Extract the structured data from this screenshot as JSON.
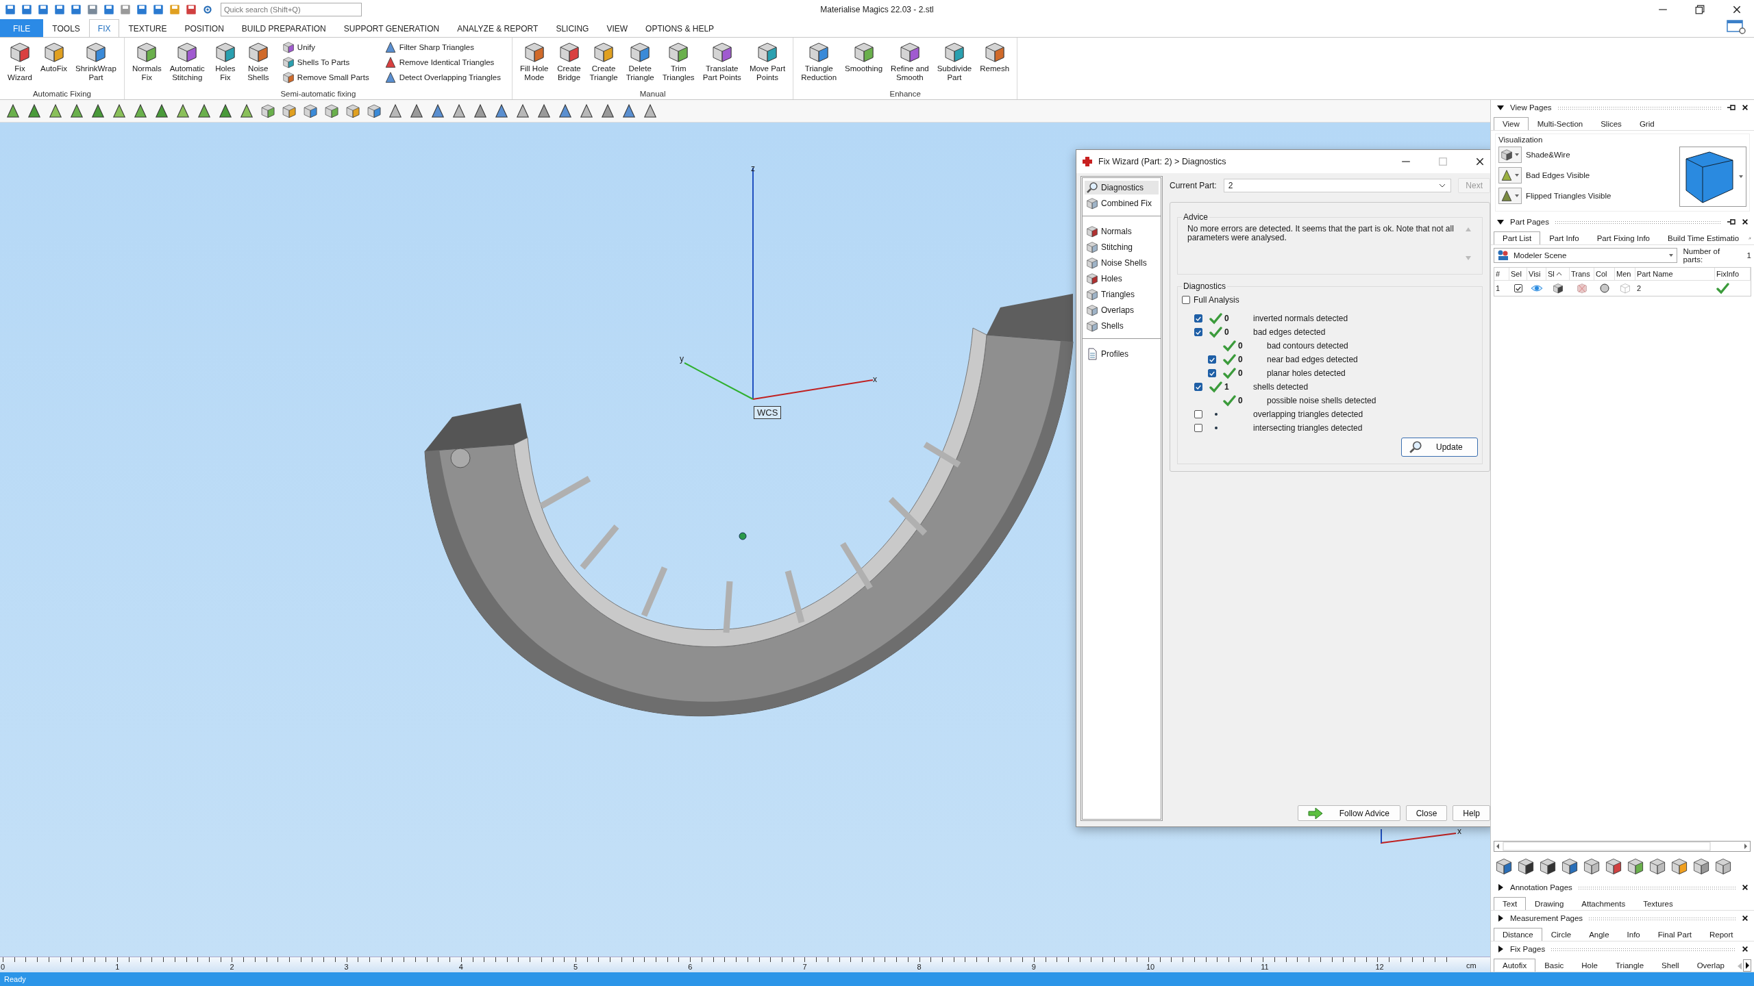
{
  "window": {
    "title": "Materialise Magics 22.03 - 2.stl"
  },
  "quick_search": {
    "placeholder": "Quick search (Shift+Q)"
  },
  "ribbon": {
    "tabs": [
      {
        "label": "FILE",
        "kind": "file",
        "selected": false
      },
      {
        "label": "TOOLS",
        "kind": "tab",
        "selected": false
      },
      {
        "label": "FIX",
        "kind": "tab",
        "selected": true
      },
      {
        "label": "TEXTURE",
        "kind": "tab",
        "selected": false
      },
      {
        "label": "POSITION",
        "kind": "tab",
        "selected": false
      },
      {
        "label": "BUILD PREPARATION",
        "kind": "tab",
        "selected": false
      },
      {
        "label": "SUPPORT GENERATION",
        "kind": "tab",
        "selected": false
      },
      {
        "label": "ANALYZE & REPORT",
        "kind": "tab",
        "selected": false
      },
      {
        "label": "SLICING",
        "kind": "tab",
        "selected": false
      },
      {
        "label": "VIEW",
        "kind": "tab",
        "selected": false
      },
      {
        "label": "OPTIONS & HELP",
        "kind": "tab",
        "selected": false
      }
    ],
    "groups": [
      {
        "label": "Automatic Fixing",
        "items": [
          {
            "kind": "large",
            "label": "Fix\nWizard"
          },
          {
            "kind": "large",
            "label": "AutoFix"
          },
          {
            "kind": "large",
            "label": "ShrinkWrap\nPart"
          }
        ]
      },
      {
        "label": "Semi-automatic fixing",
        "items": [
          {
            "kind": "large",
            "label": "Normals\nFix"
          },
          {
            "kind": "large",
            "label": "Automatic\nStitching"
          },
          {
            "kind": "large",
            "label": "Holes\nFix"
          },
          {
            "kind": "large",
            "label": "Noise\nShells"
          },
          {
            "kind": "small",
            "label": "Unify"
          },
          {
            "kind": "small",
            "label": "Shells To Parts"
          },
          {
            "kind": "small",
            "label": "Remove Small Parts"
          },
          {
            "kind": "small",
            "label": "Filter Sharp Triangles"
          },
          {
            "kind": "small",
            "label": "Remove Identical Triangles"
          },
          {
            "kind": "small",
            "label": "Detect Overlapping Triangles"
          }
        ]
      },
      {
        "label": "Manual",
        "items": [
          {
            "kind": "large",
            "label": "Fill Hole\nMode"
          },
          {
            "kind": "large",
            "label": "Create\nBridge"
          },
          {
            "kind": "large",
            "label": "Create\nTriangle"
          },
          {
            "kind": "large",
            "label": "Delete\nTriangle"
          },
          {
            "kind": "large",
            "label": "Trim\nTriangles"
          },
          {
            "kind": "large",
            "label": "Translate\nPart Points"
          },
          {
            "kind": "large",
            "label": "Move Part\nPoints"
          }
        ]
      },
      {
        "label": "Enhance",
        "items": [
          {
            "kind": "large",
            "label": "Triangle\nReduction"
          },
          {
            "kind": "large",
            "label": "Smoothing"
          },
          {
            "kind": "large",
            "label": "Refine and\nSmooth"
          },
          {
            "kind": "large",
            "label": "Subdivide\nPart"
          },
          {
            "kind": "large",
            "label": "Remesh"
          }
        ]
      }
    ]
  },
  "viewport": {
    "z_label": "z",
    "y_label": "y",
    "x_label": "x",
    "wcs_label": "WCS",
    "corner_x_label": "x"
  },
  "ruler": {
    "labels": [
      "0",
      "1",
      "2",
      "3",
      "4",
      "5",
      "6",
      "7",
      "8",
      "9",
      "10",
      "11",
      "12"
    ],
    "unit": "cm"
  },
  "status_bar": {
    "text": "Ready"
  },
  "fix_wizard": {
    "title": "Fix Wizard (Part: 2) > Diagnostics",
    "nav_groups": [
      [
        {
          "label": "Diagnostics",
          "selected": true
        },
        {
          "label": "Combined Fix",
          "selected": false
        }
      ],
      [
        {
          "label": "Normals",
          "selected": false
        },
        {
          "label": "Stitching",
          "selected": false
        },
        {
          "label": "Noise Shells",
          "selected": false
        },
        {
          "label": "Holes",
          "selected": false
        },
        {
          "label": "Triangles",
          "selected": false
        },
        {
          "label": "Overlaps",
          "selected": false
        },
        {
          "label": "Shells",
          "selected": false
        }
      ],
      [
        {
          "label": "Profiles",
          "selected": false
        }
      ]
    ],
    "current_part": {
      "label": "Current Part:",
      "value": "2"
    },
    "next_button": {
      "label": "Next",
      "disabled": true
    },
    "advice": {
      "title": "Advice",
      "text": "No more errors are detected. It seems that the part is ok. Note that not all parameters were analysed."
    },
    "diagnostics": {
      "title": "Diagnostics",
      "full_analysis": {
        "label": "Full Analysis",
        "checked": false
      },
      "rows": [
        {
          "kind": "check",
          "checked": true,
          "passed": true,
          "count": "0",
          "label": "inverted normals detected"
        },
        {
          "kind": "check",
          "checked": true,
          "passed": true,
          "count": "0",
          "label": "bad edges detected",
          "children": [
            {
              "kind": "plain",
              "passed": true,
              "count": "0",
              "label": "bad contours detected"
            },
            {
              "kind": "check",
              "checked": true,
              "passed": true,
              "count": "0",
              "label": "near bad edges detected"
            },
            {
              "kind": "check",
              "checked": true,
              "passed": true,
              "count": "0",
              "label": "planar holes detected"
            }
          ]
        },
        {
          "kind": "check",
          "checked": true,
          "passed": true,
          "count": "1",
          "label": "shells detected",
          "children": [
            {
              "kind": "plain",
              "passed": true,
              "count": "0",
              "label": "possible noise shells detected"
            }
          ]
        },
        {
          "kind": "check",
          "checked": false,
          "passed": false,
          "label": "overlapping triangles detected"
        },
        {
          "kind": "check",
          "checked": false,
          "passed": false,
          "label": "intersecting triangles detected"
        }
      ],
      "update_button": "Update"
    },
    "buttons": [
      "Follow Advice",
      "Close",
      "Help"
    ]
  },
  "view_pages": {
    "title": "View Pages",
    "expanded": true,
    "tabs": [
      {
        "label": "View",
        "selected": true
      },
      {
        "label": "Multi-Section",
        "selected": false
      },
      {
        "label": "Slices",
        "selected": false
      },
      {
        "label": "Grid",
        "selected": false
      }
    ],
    "visualization": {
      "title": "Visualization",
      "items": [
        "Shade&Wire",
        "Bad Edges Visible",
        "Flipped Triangles Visible"
      ]
    }
  },
  "part_pages": {
    "title": "Part Pages",
    "expanded": true,
    "tabs": [
      {
        "label": "Part List",
        "selected": true
      },
      {
        "label": "Part Info",
        "selected": false
      },
      {
        "label": "Part Fixing Info",
        "selected": false
      },
      {
        "label": "Build Time Estimatio",
        "selected": false
      }
    ],
    "scene": "Modeler Scene",
    "parts_count_label": "Number of parts:",
    "parts_count": "1",
    "columns": [
      "#",
      "Sel",
      "Visi",
      "Sl",
      "Trans",
      "Col",
      "Men",
      "Part Name",
      "FixInfo"
    ],
    "rows": [
      {
        "index": "1",
        "checked": true,
        "visible": true,
        "name": "2",
        "fixed": true
      }
    ]
  },
  "pages": [
    {
      "title": "Annotation Pages",
      "expanded": false,
      "tabs": [
        {
          "label": "Text",
          "selected": true
        },
        {
          "label": "Drawing",
          "selected": false
        },
        {
          "label": "Attachments",
          "selected": false
        },
        {
          "label": "Textures",
          "selected": false
        }
      ]
    },
    {
      "title": "Measurement Pages",
      "expanded": false,
      "tabs": [
        {
          "label": "Distance",
          "selected": true
        },
        {
          "label": "Circle",
          "selected": false
        },
        {
          "label": "Angle",
          "selected": false
        },
        {
          "label": "Info",
          "selected": false
        },
        {
          "label": "Final Part",
          "selected": false
        },
        {
          "label": "Report",
          "selected": false
        }
      ]
    },
    {
      "title": "Fix Pages",
      "expanded": false,
      "tabs": [
        {
          "label": "Autofix",
          "selected": true
        },
        {
          "label": "Basic",
          "selected": false
        },
        {
          "label": "Hole",
          "selected": false
        },
        {
          "label": "Triangle",
          "selected": false
        },
        {
          "label": "Shell",
          "selected": false
        },
        {
          "label": "Overlap",
          "selected": false
        }
      ]
    }
  ]
}
